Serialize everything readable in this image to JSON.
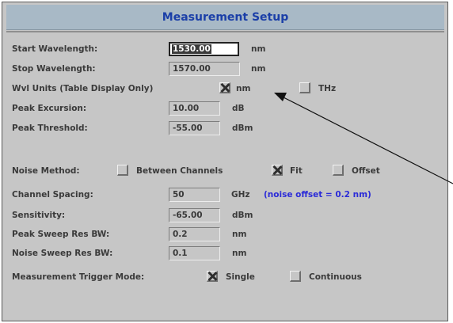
{
  "title": "Measurement Setup",
  "start_wavelength": {
    "label": "Start Wavelength:",
    "value": "1530.00",
    "unit": "nm"
  },
  "stop_wavelength": {
    "label": "Stop Wavelength:",
    "value": "1570.00",
    "unit": "nm"
  },
  "wvl_units": {
    "label": "Wvl Units (Table Display Only)",
    "nm_label": "nm",
    "nm_checked": true,
    "thz_label": "THz",
    "thz_checked": false
  },
  "peak_excursion": {
    "label": "Peak Excursion:",
    "value": "10.00",
    "unit": "dB"
  },
  "peak_threshold": {
    "label": "Peak Threshold:",
    "value": "-55.00",
    "unit": "dBm"
  },
  "noise_method": {
    "label": "Noise Method:",
    "between_label": "Between Channels",
    "between_checked": false,
    "fit_label": "Fit",
    "fit_checked": true,
    "offset_label": "Offset",
    "offset_checked": false
  },
  "channel_spacing": {
    "label": "Channel Spacing:",
    "value": "50",
    "unit": "GHz",
    "note": "(noise offset = 0.2 nm)"
  },
  "sensitivity": {
    "label": "Sensitivity:",
    "value": "-65.00",
    "unit": "dBm"
  },
  "peak_sweep_res_bw": {
    "label": "Peak Sweep Res BW:",
    "value": "0.2",
    "unit": "nm"
  },
  "noise_sweep_res_bw": {
    "label": "Noise Sweep Res BW:",
    "value": "0.1",
    "unit": "nm"
  },
  "trigger_mode": {
    "label": "Measurement Trigger Mode:",
    "single_label": "Single",
    "single_checked": true,
    "continuous_label": "Continuous",
    "continuous_checked": false
  }
}
